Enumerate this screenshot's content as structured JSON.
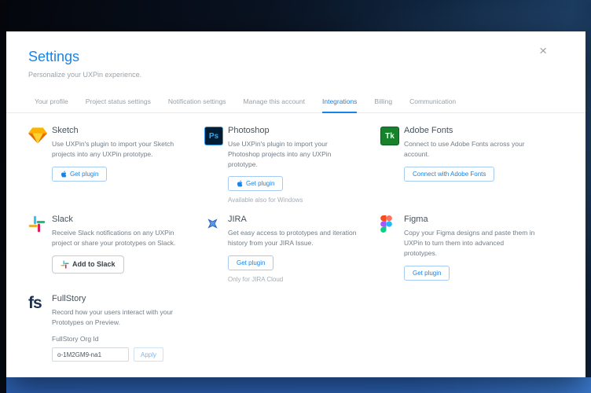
{
  "modal": {
    "title": "Settings",
    "subtitle": "Personalize your UXPin experience.",
    "close_glyph": "×"
  },
  "tabs": [
    "Your profile",
    "Project status settings",
    "Notification settings",
    "Manage this account",
    "Integrations",
    "Billing",
    "Communication"
  ],
  "active_tab": "Integrations",
  "colors": {
    "accent": "#1784e8",
    "photoshop_tile": "#001d33",
    "photoshop_text": "#31a8ff",
    "adobe_fonts_tile": "#17822b",
    "slack": [
      "#36C5F0",
      "#2EB67D",
      "#ECB22E",
      "#E01E5A"
    ],
    "sketch": [
      "#fdb300",
      "#ea6c00",
      "#fdd231"
    ],
    "figma": [
      "#F24E1E",
      "#FF7262",
      "#A259FF",
      "#1ABCFE",
      "#0ACF83"
    ]
  },
  "integrations": {
    "sketch": {
      "name": "Sketch",
      "icon": "sketch-diamond-icon",
      "description": "Use UXPin's plugin to import your Sketch projects into any UXPin prototype.",
      "button": "Get plugin"
    },
    "photoshop": {
      "name": "Photoshop",
      "icon": "photoshop-ps-icon",
      "icon_text": "Ps",
      "description": "Use UXPin's plugin to import your Photoshop projects into any UXPin prototype.",
      "button": "Get plugin",
      "note": "Available also for Windows"
    },
    "adobe_fonts": {
      "name": "Adobe Fonts",
      "icon": "adobe-fonts-tk-icon",
      "icon_text": "Tk",
      "description": "Connect to use Adobe Fonts across your account.",
      "button": "Connect with Adobe Fonts"
    },
    "slack": {
      "name": "Slack",
      "icon": "slack-icon",
      "description": "Receive Slack notifications on any UXPin project or share your prototypes on Slack.",
      "button": "Add to Slack"
    },
    "jira": {
      "name": "JIRA",
      "icon": "jira-icon",
      "description": "Get easy access to prototypes and iteration history from your JIRA Issue.",
      "button": "Get plugin",
      "note": "Only for JIRA Cloud"
    },
    "figma": {
      "name": "Figma",
      "icon": "figma-icon",
      "description": "Copy your Figma designs and paste them in UXPin to turn them into advanced prototypes.",
      "button": "Get plugin"
    },
    "fullstory": {
      "name": "FullStory",
      "icon": "fullstory-fs-icon",
      "icon_text": "fs",
      "description": "Record how your users interact with your Prototypes on Preview.",
      "field_label": "FullStory Org Id",
      "field_value": "o-1M2GM9-na1",
      "apply_label": "Apply"
    }
  }
}
